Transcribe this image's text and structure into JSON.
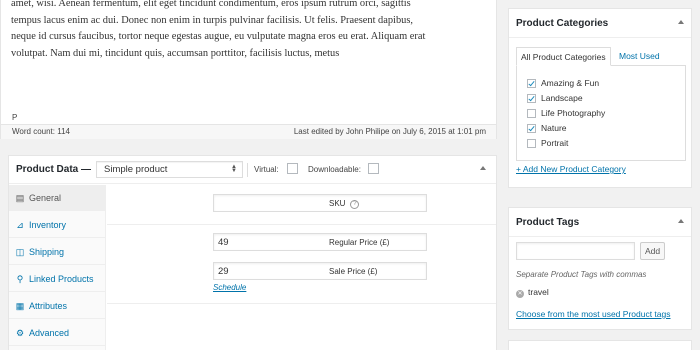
{
  "editor": {
    "lines": [
      "amet, wisi. Aenean fermentum, elit eget tincidunt condimentum, eros ipsum rutrum orci, sagittis",
      "tempus lacus enim ac dui. Donec non enim in turpis pulvinar facilisis. Ut felis. Praesent dapibus,",
      "neque id cursus faucibus, tortor neque egestas augue, eu vulputate magna eros eu erat. Aliquam erat",
      "volutpat. Nam dui mi, tincidunt quis, accumsan porttitor, facilisis luctus, metus"
    ],
    "path": "P",
    "word_count": "Word count: 114",
    "last_edited": "Last edited by John Philipe on July 6, 2015 at 1:01 pm"
  },
  "product_data": {
    "title": "Product Data —",
    "type_select": "Simple product",
    "virtual_label": "Virtual:",
    "downloadable_label": "Downloadable:",
    "tabs": [
      "General",
      "Inventory",
      "Shipping",
      "Linked Products",
      "Attributes",
      "Advanced"
    ],
    "tab_icons": [
      "list-icon",
      "chart-icon",
      "truck-icon",
      "link-icon",
      "table-icon",
      "gear-icon"
    ],
    "sku_label": "SKU",
    "regular_price_value": "49",
    "regular_price_label": "Regular Price (£)",
    "sale_price_value": "29",
    "sale_price_label": "Sale Price (£)",
    "schedule_link": "Schedule"
  },
  "categories": {
    "title": "Product Categories",
    "tab_all": "All Product Categories",
    "tab_most_used": "Most Used",
    "items": [
      {
        "label": "Amazing & Fun",
        "checked": true
      },
      {
        "label": "Landscape",
        "checked": true
      },
      {
        "label": "Life Photography",
        "checked": false
      },
      {
        "label": "Nature",
        "checked": true
      },
      {
        "label": "Portrait",
        "checked": false
      }
    ],
    "add_link": "+ Add New Product Category"
  },
  "tags": {
    "title": "Product Tags",
    "input_value": "",
    "add_button": "Add",
    "help": "Separate Product Tags with commas",
    "tag": "travel",
    "choose_link": "Choose from the most used Product tags"
  },
  "colors": {
    "link": "#0073aa",
    "checkmark": "#1e8cbe",
    "background": "#f1f1f1"
  }
}
